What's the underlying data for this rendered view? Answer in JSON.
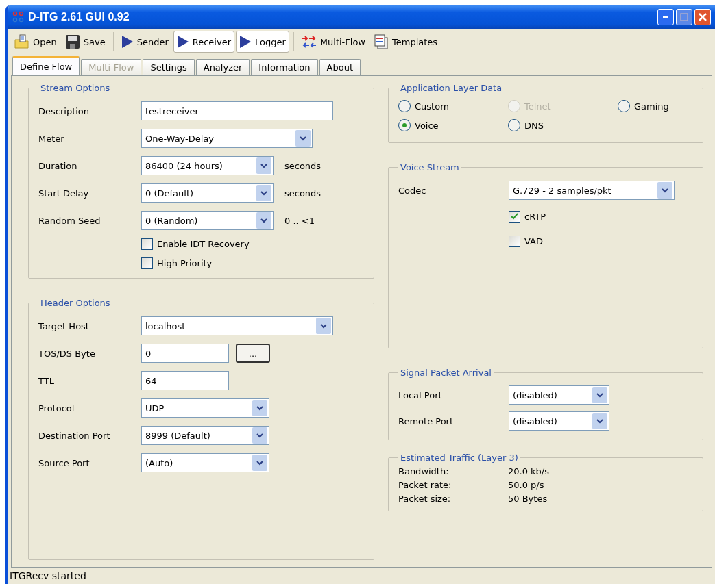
{
  "window": {
    "title": "D-ITG 2.61 GUI 0.92"
  },
  "toolbar": [
    {
      "label": "Open",
      "pressed": false
    },
    {
      "label": "Save",
      "pressed": false
    },
    {
      "label": "Sender",
      "pressed": false
    },
    {
      "label": "Receiver",
      "pressed": true
    },
    {
      "label": "Logger",
      "pressed": true
    },
    {
      "label": "Multi-Flow",
      "pressed": false
    },
    {
      "label": "Templates",
      "pressed": false
    }
  ],
  "tabs": [
    {
      "label": "Define Flow",
      "selected": true,
      "disabled": false
    },
    {
      "label": "Multi-Flow",
      "selected": false,
      "disabled": true
    },
    {
      "label": "Settings",
      "selected": false,
      "disabled": false
    },
    {
      "label": "Analyzer",
      "selected": false,
      "disabled": false
    },
    {
      "label": "Information",
      "selected": false,
      "disabled": false
    },
    {
      "label": "About",
      "selected": false,
      "disabled": false
    }
  ],
  "stream_options": {
    "title": "Stream Options",
    "fields": [
      {
        "label": "Description",
        "kind": "text",
        "value": "testreceiver"
      },
      {
        "label": "Meter",
        "kind": "select",
        "value": "One-Way-Delay"
      },
      {
        "label": "Duration",
        "kind": "select",
        "value": "86400 (24 hours)",
        "suffix": "seconds"
      },
      {
        "label": "Start Delay",
        "kind": "select",
        "value": "0 (Default)",
        "suffix": "seconds"
      },
      {
        "label": "Random Seed",
        "kind": "select",
        "value": "0 (Random)",
        "suffix": "0 .. <1"
      }
    ],
    "checkboxes": [
      {
        "label": "Enable IDT Recovery",
        "checked": false
      },
      {
        "label": "High Priority",
        "checked": false
      }
    ]
  },
  "header_options": {
    "title": "Header Options",
    "fields": [
      {
        "label": "Target Host",
        "kind": "select",
        "value": "localhost"
      },
      {
        "label": "TOS/DS Byte",
        "kind": "text",
        "value": "0",
        "button": "..."
      },
      {
        "label": "TTL",
        "kind": "text",
        "value": "64"
      },
      {
        "label": "Protocol",
        "kind": "select",
        "value": "UDP"
      },
      {
        "label": "Destination Port",
        "kind": "select",
        "value": "8999 (Default)"
      },
      {
        "label": "Source Port",
        "kind": "select",
        "value": "(Auto)"
      }
    ]
  },
  "application_layer_data": {
    "title": "Application Layer Data",
    "options": [
      {
        "label": "Custom",
        "selected": false,
        "disabled": false
      },
      {
        "label": "Telnet",
        "selected": false,
        "disabled": true
      },
      {
        "label": "Gaming",
        "selected": false,
        "disabled": false
      },
      {
        "label": "Voice",
        "selected": true,
        "disabled": false
      },
      {
        "label": "DNS",
        "selected": false,
        "disabled": false
      }
    ]
  },
  "voice_stream": {
    "title": "Voice Stream",
    "codec_label": "Codec",
    "codec_value": "G.729 - 2 samples/pkt",
    "checkboxes": [
      {
        "label": "cRTP",
        "checked": true
      },
      {
        "label": "VAD",
        "checked": false
      }
    ]
  },
  "signal_packet_arrival": {
    "title": "Signal Packet Arrival",
    "fields": [
      {
        "label": "Local Port",
        "kind": "select",
        "value": "(disabled)"
      },
      {
        "label": "Remote Port",
        "kind": "select",
        "value": "(disabled)"
      }
    ]
  },
  "estimated_traffic": {
    "title": "Estimated Traffic (Layer 3)",
    "rows": [
      {
        "label": "Bandwidth:",
        "value": "20.0 kb/s"
      },
      {
        "label": "Packet rate:",
        "value": "50.0 p/s"
      },
      {
        "label": "Packet size:",
        "value": "50 Bytes"
      }
    ]
  },
  "status_bar": {
    "text": "ITGRecv started"
  }
}
